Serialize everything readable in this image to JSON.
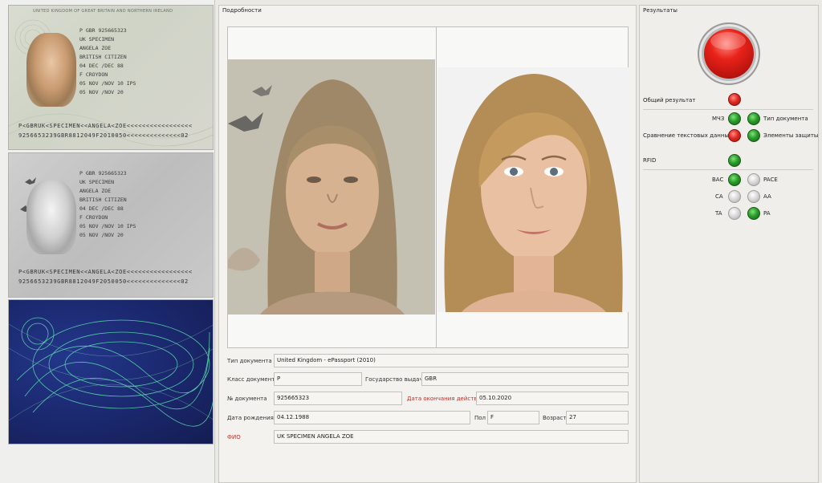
{
  "scans": {
    "header": "UNITED KINGDOM OF GREAT BRITAIN AND NORTHERN IRELAND",
    "white": {
      "lines": [
        "P          GBR    925665323",
        "UK SPECIMEN",
        "ANGELA ZOE",
        "BRITISH CITIZEN",
        "04 DEC /DEC 88",
        "F          CROYDON",
        "05 NOV /NOV 10   IPS",
        "05 NOV /NOV 20"
      ],
      "mrz": [
        "P<GBRUK<SPECIMEN<<ANGELA<ZOE<<<<<<<<<<<<<<<<<",
        "9256653239GBR8812049F2010050<<<<<<<<<<<<<<02"
      ]
    },
    "ir": {
      "lines": [
        "P          GBR    925665323",
        "UK SPECIMEN",
        "ANGELA ZOE",
        "BRITISH CITIZEN",
        "04 DEC /DEC 88",
        "F          CROYDON",
        "05 NOV /NOV 10   IPS",
        "05 NOV /NOV 20"
      ],
      "mrz": [
        "P<GBRUK<SPECIMEN<<ANGELA<ZOE<<<<<<<<<<<<<<<<<",
        "9256653239GBR8812049F2050050<<<<<<<<<<<<<<02"
      ]
    }
  },
  "details": {
    "title": "Подробности",
    "doc_type_label": "Тип документа",
    "doc_type": "United Kingdom - ePassport (2010)",
    "doc_class_label": "Класс документа",
    "doc_class": "P",
    "issuing_state_label": "Государство выдачи",
    "issuing_state": "GBR",
    "doc_number_label": "№ документа",
    "doc_number": "925665323",
    "expiry_label": "Дата окончания действия",
    "expiry": "05.10.2020",
    "birth_label": "Дата рождения",
    "birth": "04.12.1988",
    "sex_label": "Пол",
    "sex": "F",
    "age_label": "Возраст",
    "age": "27",
    "name_label": "ФИО",
    "name": "UK SPECIMEN ANGELA ZOE"
  },
  "results": {
    "title": "Результаты",
    "overall_label": "Общий результат",
    "mrz_label": "МЧЗ",
    "doctype_label": "Тип документа",
    "textcmp_label": "Сравнение текстовых данных",
    "security_label": "Элементы защиты",
    "rfid_label": "RFID",
    "bac_label": "BAC",
    "pace_label": "PACE",
    "ca_label": "CA",
    "aa_label": "AA",
    "ta_label": "TA",
    "pa_label": "PA"
  },
  "colors": {
    "fail": "#e02a22",
    "pass": "#2b9d2a",
    "not_checked": "#d6d6d6",
    "accent_label": "#c0302a"
  }
}
